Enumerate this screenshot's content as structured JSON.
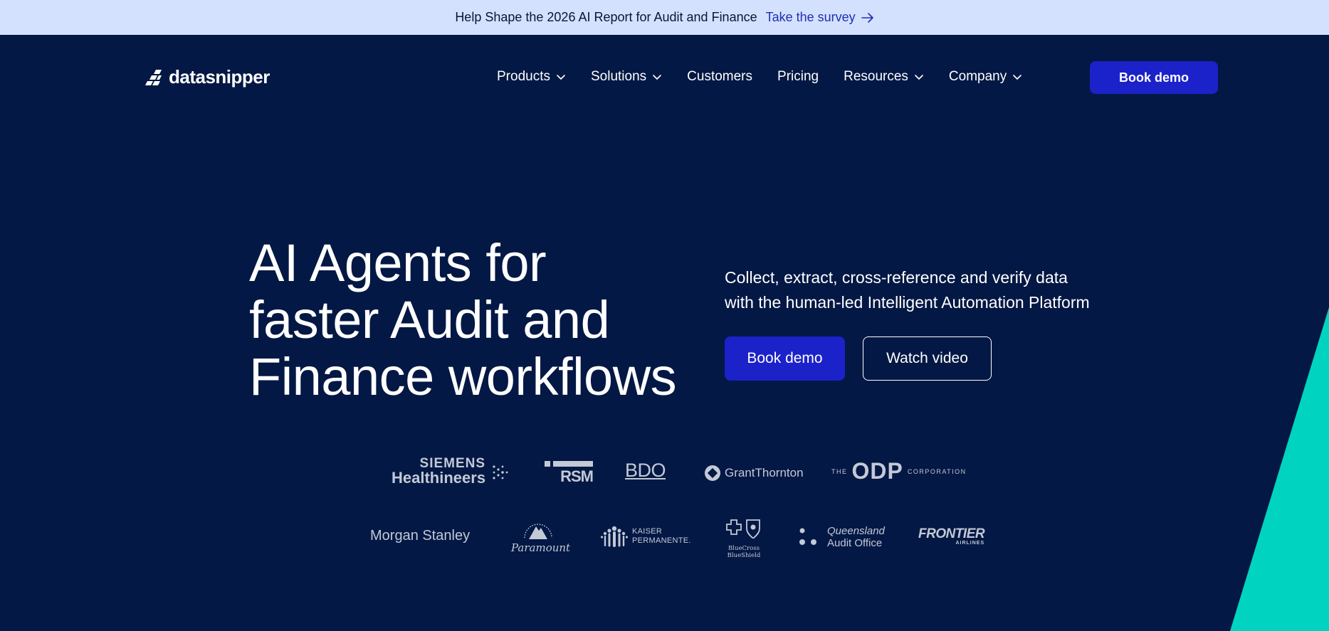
{
  "announcement": {
    "text": "Help Shape the 2026 AI Report for Audit and Finance",
    "link_label": "Take the survey",
    "link_icon": "arrow-right-icon"
  },
  "nav": {
    "logo_text": "datasnipper",
    "items": [
      {
        "label": "Products",
        "has_dropdown": true
      },
      {
        "label": "Solutions",
        "has_dropdown": true
      },
      {
        "label": "Customers",
        "has_dropdown": false
      },
      {
        "label": "Pricing",
        "has_dropdown": false
      },
      {
        "label": "Resources",
        "has_dropdown": true
      },
      {
        "label": "Company",
        "has_dropdown": true
      }
    ],
    "cta_label": "Book demo"
  },
  "hero": {
    "headline_line1": "AI Agents for",
    "headline_line2": "faster Audit and",
    "headline_line3": "Finance workflows",
    "subtext_line1": "Collect, extract, cross-reference and verify data",
    "subtext_line2": "with the human-led Intelligent Automation Platform",
    "primary_cta": "Book demo",
    "secondary_cta": "Watch video"
  },
  "customer_logos": {
    "siemens_top": "SIEMENS",
    "siemens_bottom": "Healthineers",
    "rsm": "RSM",
    "bdo": "BDO",
    "grant_thornton": "GrantThornton",
    "odp_prefix": "THE",
    "odp_main": "ODP",
    "odp_suffix": "CORPORATION",
    "morgan_stanley": "Morgan Stanley",
    "paramount": "Paramount",
    "kaiser_top": "KAISER",
    "kaiser_bottom": "PERMANENTE.",
    "bcbs_top": "BlueCross",
    "bcbs_bottom": "BlueShield",
    "qao_top": "Queensland",
    "qao_bottom": "Audit Office",
    "frontier_top": "FRONTIER",
    "frontier_bottom": "AIRLINES"
  },
  "colors": {
    "background": "#031844",
    "announcement_bg": "#d3e1ff",
    "primary_button": "#1c22c9",
    "accent_teal": "#00d4c1",
    "link": "#1f2fb3"
  }
}
